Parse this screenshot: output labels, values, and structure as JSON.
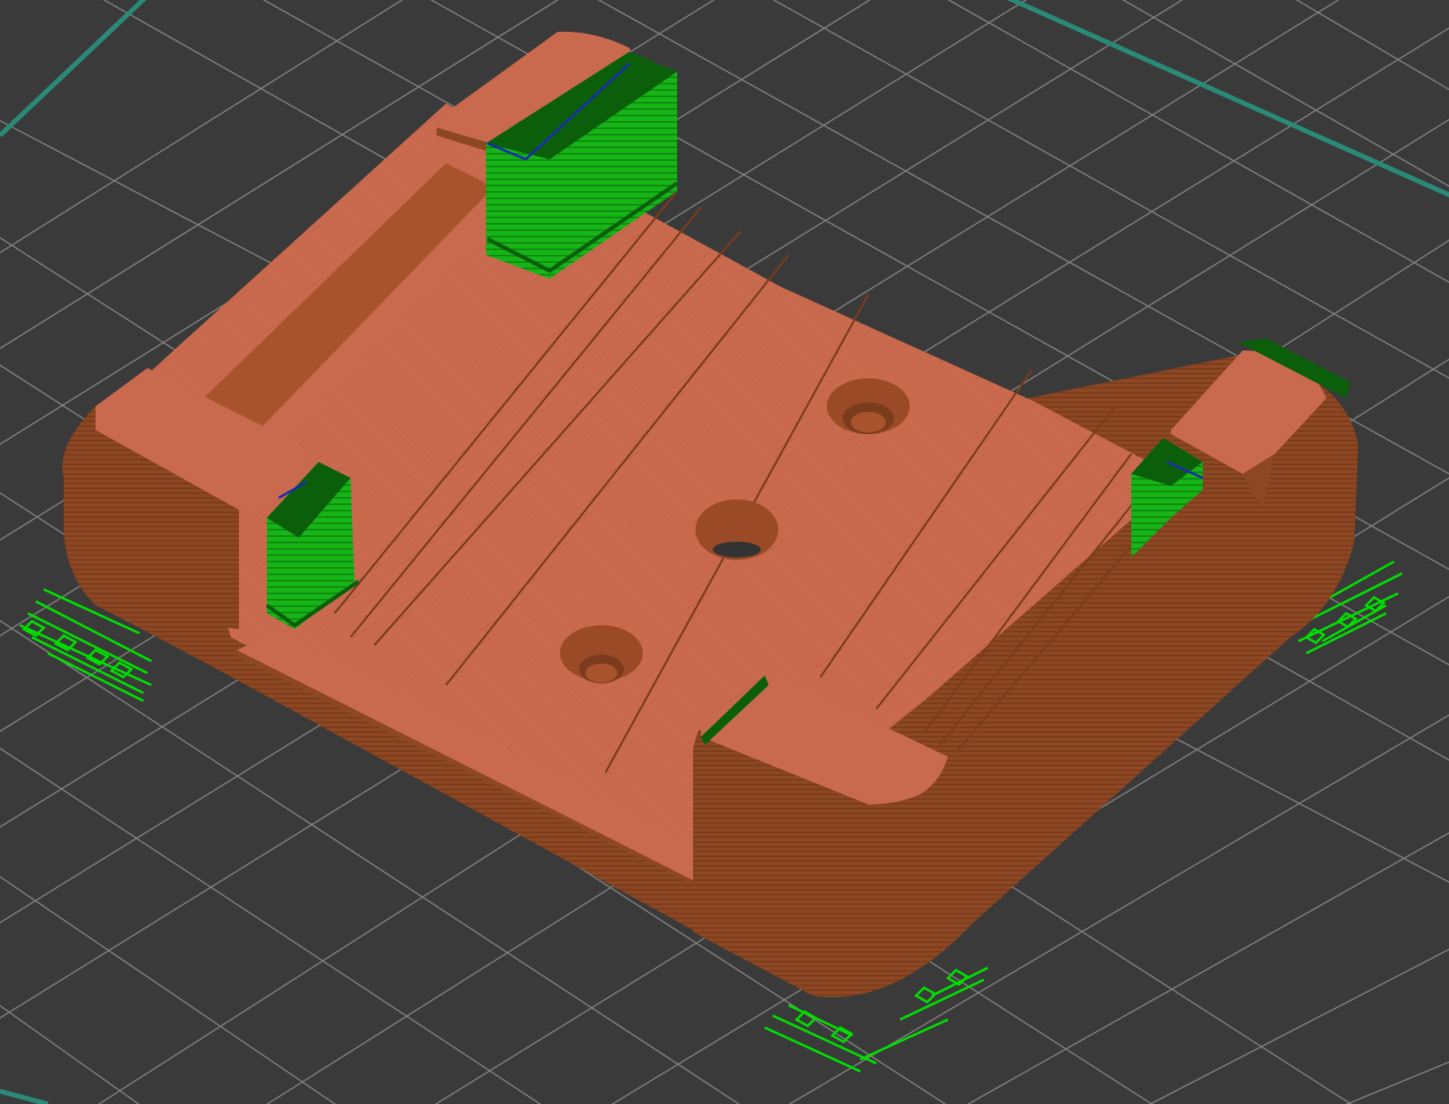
{
  "app": {
    "view": "slicer-preview-3d"
  },
  "scene": {
    "background_color": "#3a3a3a",
    "grid_line_color": "#8e8e8e",
    "bed_edge_color": "#2a8a78",
    "model_top_color": "#c96a4e",
    "model_wall_color": "#8d4722",
    "model_wall_dark_color": "#7a3c1c",
    "support_color": "#17b417",
    "support_dark_color": "#0b5f0b",
    "support_interface_color": "#1a2bb0",
    "brim_outline_color": "#00e000"
  },
  "objects": [
    {
      "name": "printed-part",
      "features": [
        "raised-corner-pads",
        "screw-holes",
        "slots"
      ]
    },
    {
      "name": "support-structures",
      "count": 4
    },
    {
      "name": "support-brims",
      "count": 4
    }
  ]
}
